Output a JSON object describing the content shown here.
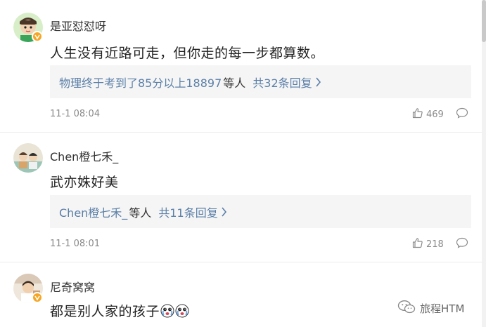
{
  "comments": [
    {
      "username": "是亚怼怼呀",
      "text": "人生没有近路可走，但你走的每一步都算数。",
      "reply_names": "物理终于考到了85分以上18897",
      "reply_suffix": "等人",
      "reply_count": "共32条回复",
      "timestamp": "11-1 08:04",
      "likes": "469"
    },
    {
      "username": "Chen橙七禾_",
      "text": "武亦姝好美",
      "reply_names": "Chen橙七禾_",
      "reply_suffix": "等人",
      "reply_count": "共11条回复",
      "timestamp": "11-1 08:01",
      "likes": "218"
    },
    {
      "username": "尼奇窝窝",
      "text": "都是别人家的孩子"
    }
  ],
  "watermark": {
    "label": "旅程HTM"
  },
  "colors": {
    "link": "#5b7fa8",
    "verified": "#f6a623",
    "reply_bg": "#f5f5f5"
  }
}
